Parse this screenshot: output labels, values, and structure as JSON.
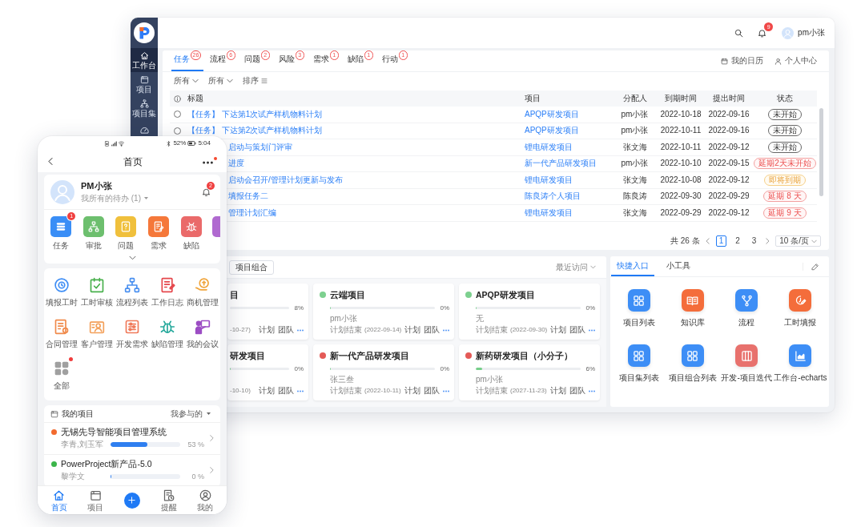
{
  "desktop": {
    "sidebar": {
      "items": [
        {
          "label": "工作台",
          "selected": true
        },
        {
          "label": "项目",
          "selected": false
        },
        {
          "label": "项目集",
          "selected": false
        },
        {
          "selected": false
        }
      ]
    },
    "header": {
      "notifications": "9",
      "user": "pm小张"
    },
    "task_panel": {
      "tabs": [
        {
          "label": "任务",
          "count": "26",
          "selected": true
        },
        {
          "label": "流程",
          "count": "6",
          "selected": false
        },
        {
          "label": "问题",
          "count": "2",
          "selected": false
        },
        {
          "label": "风险",
          "count": "3",
          "selected": false
        },
        {
          "label": "需求",
          "count": "1",
          "selected": false
        },
        {
          "label": "缺陷",
          "count": "1",
          "selected": false
        },
        {
          "label": "行动",
          "count": "1",
          "selected": false
        }
      ],
      "links": [
        {
          "label": "我的日历",
          "kind": "calendar"
        },
        {
          "label": "个人中心",
          "kind": "user"
        }
      ],
      "filters": [
        {
          "label": "所有",
          "kind": "dropdown"
        },
        {
          "label": "所有",
          "kind": "dropdown"
        },
        {
          "label": "排序",
          "kind": "sort"
        }
      ],
      "table": {
        "columns": [
          "标题",
          "项目",
          "分配人",
          "到期时间",
          "提出时间",
          "状态"
        ],
        "rows": [
          {
            "checked": false,
            "title": "【任务】 下达第1次试产样机物料计划",
            "project": "APQP研发项目",
            "assignee": "pm小张",
            "due": "2022-10-18",
            "created": "2022-09-16",
            "status": {
              "label": "未开始",
              "kind": "not_started"
            }
          },
          {
            "checked": false,
            "title": "【任务】 下达第2次试产样机物料计划",
            "project": "APQP研发项目",
            "assignee": "pm小张",
            "due": "2022-10-11",
            "created": "2022-09-16",
            "status": {
              "label": "未开始",
              "kind": "not_started"
            }
          },
          {
            "title": "启动与策划门评审",
            "project": "锂电研发项目",
            "assignee": "张文海",
            "due": "2022-10-11",
            "created": "2022-09-12",
            "status": {
              "label": "未开始",
              "kind": "not_started"
            }
          },
          {
            "title": "进度",
            "project": "新一代产品研发项目",
            "assignee": "pm小张",
            "due": "2022-10-10",
            "created": "2022-09-15",
            "status": {
              "label": "延期2天未开始",
              "kind": "overdue"
            }
          },
          {
            "title": "启动会召开/管理计划更新与发布",
            "project": "锂电研发项目",
            "assignee": "张文海",
            "due": "2022-10-08",
            "created": "2022-09-12",
            "status": {
              "label": "即将到期",
              "kind": "due_soon"
            }
          },
          {
            "title": "填报任务二",
            "project": "陈良涛个人项目",
            "assignee": "陈良涛",
            "due": "2022-09-30",
            "created": "2022-09-29",
            "status": {
              "label": "延期 8 天",
              "kind": "overdue"
            }
          },
          {
            "title": "管理计划汇编",
            "project": "锂电研发项目",
            "assignee": "张文海",
            "due": "2022-09-29",
            "created": "2022-09-12",
            "status": {
              "label": "延期 9 天",
              "kind": "overdue"
            }
          }
        ]
      },
      "pagination": {
        "total": "共 26 条",
        "pages": [
          {
            "label": "1",
            "selected": true
          },
          {
            "label": "2",
            "selected": false
          },
          {
            "label": "3",
            "selected": false
          }
        ],
        "page_size": "10 条/页"
      }
    },
    "project_panel": {
      "tabs": [
        {
          "label": "项目组合",
          "selected": false
        }
      ],
      "sort": "最近访问",
      "cards": [
        {
          "title": "目",
          "progress": "8%",
          "plan_end": "-10-27)",
          "actions": [
            "计划",
            "团队"
          ]
        },
        {
          "title": "云端项目",
          "color": "#7dd08f",
          "level": 0,
          "progress": "0%",
          "owner": "pm小张",
          "plan_end_label": "计划结束",
          "plan_end": "(2022-09-14)",
          "actions": [
            "计划",
            "团队"
          ]
        },
        {
          "title": "APQP研发项目",
          "color": "#7dd08f",
          "level": 0,
          "progress": "0%",
          "owner": "无",
          "plan_end_label": "计划结束",
          "plan_end": "(2022-09-30)",
          "actions": [
            "计划",
            "团队"
          ]
        },
        {
          "title": "研发项目",
          "level": 0,
          "progress": "0%",
          "plan_end": "-10-10)",
          "actions": [
            "计划",
            "团队"
          ]
        },
        {
          "title": "新一代产品研发项目",
          "color": "#e45a57",
          "level": 0,
          "progress": "0%",
          "owner": "张三叁",
          "plan_end_label": "计划结束",
          "plan_end": "(2022-10-11)",
          "actions": [
            "计划",
            "团队"
          ]
        },
        {
          "title": "新药研发项目（小分子）",
          "color": "#e45a57",
          "level": 0.06,
          "progress": "6%",
          "owner": "pm小张",
          "plan_end_label": "计划结束",
          "plan_end": "(2027-11-23)",
          "actions": [
            "计划",
            "团队"
          ]
        }
      ]
    },
    "quick_panel": {
      "tabs": [
        {
          "label": "快捷入口",
          "selected": true
        },
        {
          "label": "小工具",
          "selected": false
        }
      ],
      "items": [
        {
          "label": "项目列表",
          "kind": "grid",
          "color": "#3d8ef6"
        },
        {
          "label": "知识库",
          "kind": "book",
          "color": "#f46d3b"
        },
        {
          "label": "流程",
          "kind": "fork",
          "color": "#3d8ef6"
        },
        {
          "label": "工时填报",
          "kind": "clock",
          "color": "#f46d3b"
        },
        {
          "label": "项目集列表",
          "kind": "grid",
          "color": "#3d8ef6"
        },
        {
          "label": "项目组合列表",
          "kind": "grid",
          "color": "#3d8ef6"
        },
        {
          "label": "开发-项目迭代",
          "kind": "columns",
          "color": "#e8716d"
        },
        {
          "label": "工作台-echarts",
          "kind": "chart",
          "color": "#3d8ef6"
        }
      ]
    }
  },
  "phone": {
    "status_bar": {
      "battery": "52%",
      "time": "5:04"
    },
    "nav": {
      "title": "首页",
      "menu_notice": true
    },
    "profile": {
      "name": "PM小张",
      "todo": "我所有的待办 (1)",
      "notifications": "2"
    },
    "modules": [
      {
        "label": "任务",
        "kind": "list",
        "color": "#3a8ef6",
        "badge": "1"
      },
      {
        "label": "审批",
        "kind": "tree",
        "color": "#6dbf6e"
      },
      {
        "label": "问题",
        "kind": "question",
        "color": "#f0c03c"
      },
      {
        "label": "需求",
        "kind": "doc",
        "color": "#f5783a"
      },
      {
        "label": "缺陷",
        "kind": "bug",
        "color": "#ea6a6a"
      },
      {
        "kind": "board",
        "color": "#b06ad0"
      }
    ],
    "shortcuts": [
      {
        "label": "填报工时",
        "kind": "clock",
        "notice": false
      },
      {
        "label": "工时审核",
        "kind": "check",
        "notice": false
      },
      {
        "label": "流程列表",
        "kind": "tree",
        "notice": false
      },
      {
        "label": "工作日志",
        "kind": "log",
        "notice": false
      },
      {
        "label": "商机管理",
        "kind": "coin",
        "notice": false
      },
      {
        "label": "合同管理",
        "kind": "contract",
        "notice": false
      },
      {
        "label": "客户管理",
        "kind": "customer",
        "notice": false
      },
      {
        "label": "开发需求",
        "kind": "sliders",
        "notice": false
      },
      {
        "label": "缺陷管理",
        "kind": "bug",
        "notice": false
      },
      {
        "label": "我的会议",
        "kind": "meeting",
        "notice": false
      },
      {
        "label": "全部",
        "kind": "all",
        "notice": true
      }
    ],
    "my_projects": {
      "title": "我的项目",
      "filter": "我参与的",
      "items": [
        {
          "name": "无锡先导智能项目管理系统",
          "color": "#f26a2e",
          "members": "李青,刘玉军",
          "level": 0.53,
          "progress": "53 %"
        },
        {
          "name": "PowerProject新产品-5.0",
          "color": "#3bb54a",
          "members": "黎学文",
          "level": 0,
          "progress": "0 %"
        }
      ]
    },
    "tabbar": [
      {
        "label": "首页",
        "kind": "home",
        "selected": true
      },
      {
        "label": "项目",
        "kind": "project",
        "selected": false
      },
      {
        "kind": "add",
        "selected": false
      },
      {
        "label": "提醒",
        "kind": "remind",
        "selected": false
      },
      {
        "label": "我的",
        "kind": "me",
        "selected": false
      }
    ]
  }
}
